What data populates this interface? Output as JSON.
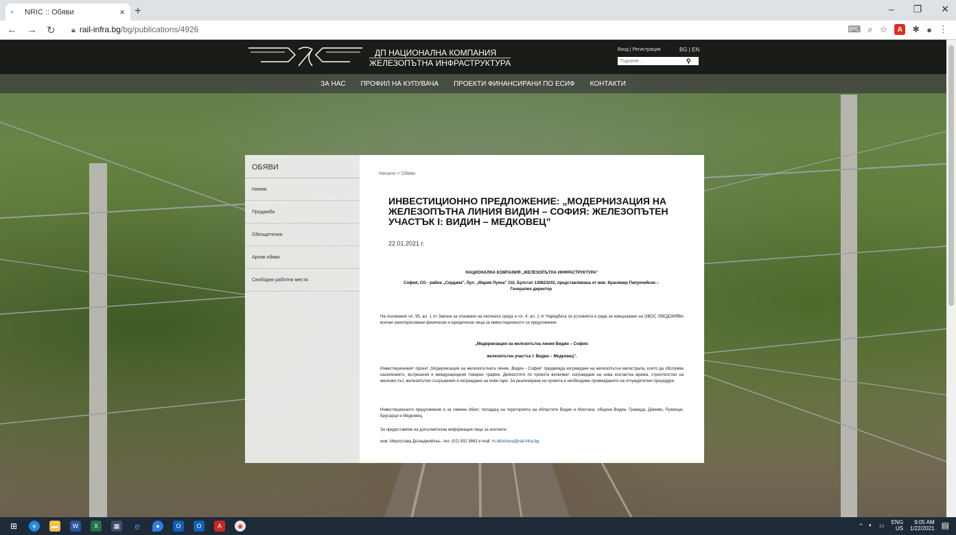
{
  "browser": {
    "tab_title": "NRIC :: Обяви",
    "tab_icon": "nric-logo-icon",
    "new_tab": "+",
    "url_host": "rail-infra.bg",
    "url_path": "/bg/publications/4926"
  },
  "site": {
    "company_line1": "ДП НАЦИОНАЛНА КОМПАНИЯ",
    "company_line2": "ЖЕЛЕЗОПЪТНА ИНФРАСТРУКТУРА",
    "login": "Вход | Регистрация",
    "lang": "BG | EN",
    "search_placeholder": "Търсене...",
    "nav": [
      "ЗА НАС",
      "ПРОФИЛ НА КУПУВАЧА",
      "ПРОЕКТИ ФИНАНСИРАНИ ПО ЕСИФ",
      "КОНТАКТИ"
    ]
  },
  "sidebar": {
    "heading": "ОБЯВИ",
    "items": [
      "Наеми",
      "Продажби",
      "Обезщетения",
      "Архив обяви",
      "Свободни работни места"
    ]
  },
  "article": {
    "breadcrumb": "Начало > Обяви",
    "title": "ИНВЕСТИЦИОННО ПРЕДЛОЖЕНИЕ: „МОДЕРНИЗАЦИЯ НА ЖЕЛЕЗОПЪТНА ЛИНИЯ ВИДИН – СОФИЯ: ЖЕЛЕЗОПЪТЕН УЧАСТЪК I: ВИДИН – МЕДКОВЕЦ”",
    "date": "22.01.2021 г.",
    "org_name": "НАЦИОНАЛНА КОМПАНИЯ „ЖЕЛЕЗОПЪТНА ИНФРАСТРУКТУРА”",
    "org_address": "София, СО - район „Сердика”, бул. „Мария Луиза” 110, Булстат 130823243, представлявана от инж. Красимир Папукчийски – Генерален директор",
    "para1": "На основание чл. 95, ал. 1 от Закона за опазване на околната среда и чл. 4, ал. 1 от Наредбата за условията и реда за извършване на ОВОС УВЕДОМЯВА всички заинтересовани физически и юридически лица за инвестиционното си предложение",
    "project_line1": "„Модернизация на железопътна линия Видин – София:",
    "project_line2": "железопътен участък I: Видин – Медковец”.",
    "para2": "Инвестиционният проект „Модернизация на железопътната линия „Видин - София” предвижда изграждане на железопътна магистрала, която да обслужва населението, вътрешния и международния товарен трафик. Дейностите по проекта включват: изграждане на нова контактна мрежа, строителство на железен път, железопътни съоръжения и изграждане на нови гари. За реализиране на проекта е необходимо провеждането на отчуждителни процедури.",
    "para3": "Инвестиционното предложение е за линеен обект, попадащ на територията на областите Видин и Монтана, общини Видин, Грамада, Димово, Ружинци, Брусарци и Медковец.",
    "para4": "За предоставяне на допълнителна информация лице за контакти:",
    "contact_text": "инж. Мирослава Доганджийска– тел. (02) 932 3863 e-mail: ",
    "contact_email": "m.dimcheva@rail-infra.bg"
  },
  "tray": {
    "lang1": "ENG",
    "lang2": "US",
    "time": "9:05 AM",
    "date": "1/22/2021"
  },
  "colors": {
    "header_bg": "#141414",
    "link": "#1a4da2"
  }
}
